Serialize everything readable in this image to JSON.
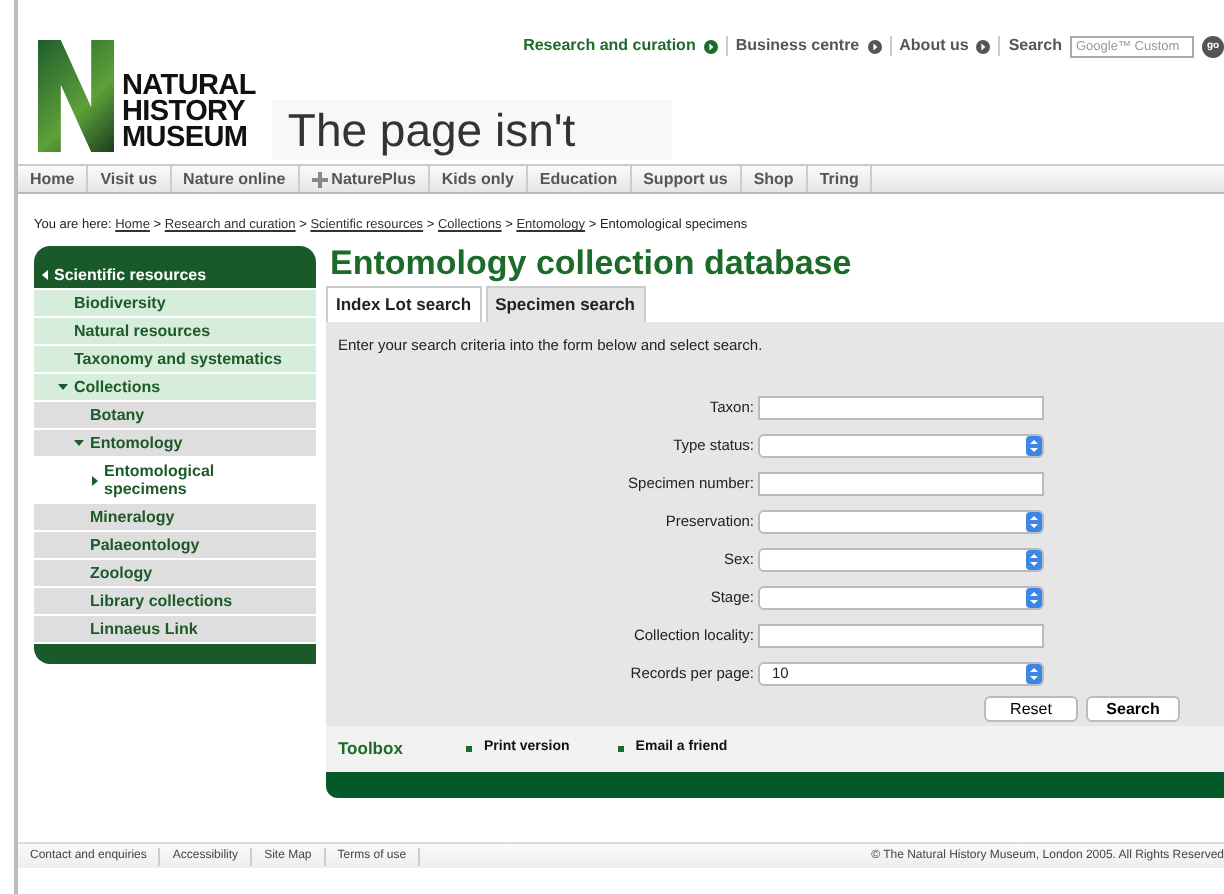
{
  "header": {
    "logo_lines": [
      "NATURAL",
      "HISTORY",
      "MUSEUM"
    ],
    "tagline": "The page isn't",
    "top_links": [
      {
        "label": "Research and curation",
        "selected": true
      },
      {
        "label": "Business centre",
        "selected": false
      },
      {
        "label": "About us",
        "selected": false
      }
    ],
    "search": {
      "label": "Search",
      "placeholder": "Google™ Custom",
      "button": "go"
    }
  },
  "nav": [
    {
      "label": "Home",
      "kind": "plain"
    },
    {
      "label": "Visit us",
      "kind": "plain"
    },
    {
      "label": "Nature online",
      "kind": "plain"
    },
    {
      "label": "NaturePlus",
      "kind": "icon"
    },
    {
      "label": "Kids only",
      "kind": "plain"
    },
    {
      "label": "Education",
      "kind": "plain"
    },
    {
      "label": "Support us",
      "kind": "plain"
    },
    {
      "label": "Shop",
      "kind": "plain"
    },
    {
      "label": "Tring",
      "kind": "plain"
    }
  ],
  "breadcrumb": {
    "prefix": "You are here:",
    "links": [
      "Home",
      "Research and curation",
      "Scientific resources",
      "Collections",
      "Entomology"
    ],
    "separator": ">",
    "current": "Entomological specimens"
  },
  "sidebar": {
    "items": [
      {
        "label": "Scientific resources",
        "expanded": true,
        "selected": false,
        "children": [
          {
            "label": "Biodiversity",
            "selected": false
          },
          {
            "label": "Natural resources",
            "selected": false
          },
          {
            "label": "Taxonomy and systematics",
            "selected": false
          },
          {
            "label": "Collections",
            "expanded": true,
            "selected": false,
            "children": [
              {
                "label": "Botany",
                "selected": false
              },
              {
                "label": "Entomology",
                "expanded": true,
                "selected": false,
                "children": [
                  {
                    "label": "Entomological specimens",
                    "selected": true
                  }
                ]
              },
              {
                "label": "Mineralogy",
                "selected": false
              },
              {
                "label": "Palaeontology",
                "selected": false
              },
              {
                "label": "Zoology",
                "selected": false
              },
              {
                "label": "Library collections",
                "selected": false
              },
              {
                "label": "Linnaeus Link",
                "selected": false
              }
            ]
          }
        ]
      }
    ]
  },
  "title": "Entomology collection database",
  "tabs": [
    {
      "label": "Index Lot search",
      "selected": true
    },
    {
      "label": "Specimen search",
      "selected": false
    }
  ],
  "instructions": "Enter your search criteria into the form below and select search.",
  "fields": [
    {
      "label": "Taxon:",
      "kind": "text"
    },
    {
      "label": "Type status:",
      "kind": "select"
    },
    {
      "label": "Specimen number:",
      "kind": "text"
    },
    {
      "label": "Preservation:",
      "kind": "select"
    },
    {
      "label": "Sex:",
      "kind": "select"
    },
    {
      "label": "Stage:",
      "kind": "select"
    },
    {
      "label": "Collection locality:",
      "kind": "text"
    },
    {
      "label": "Records per page:",
      "kind": "select",
      "value": "10"
    }
  ],
  "buttons": [
    {
      "label": "Reset",
      "kind": "reset"
    },
    {
      "label": "Search",
      "kind": "submit"
    }
  ],
  "toolbox": {
    "title": "Toolbox",
    "links": [
      "Print version",
      "Email a friend"
    ]
  },
  "footer": {
    "links": [
      "Contact and enquiries",
      "Accessibility",
      "Site Map",
      "Terms of use"
    ],
    "copyright": "© The Natural History Museum, London 2005. All Rights Reserved"
  }
}
